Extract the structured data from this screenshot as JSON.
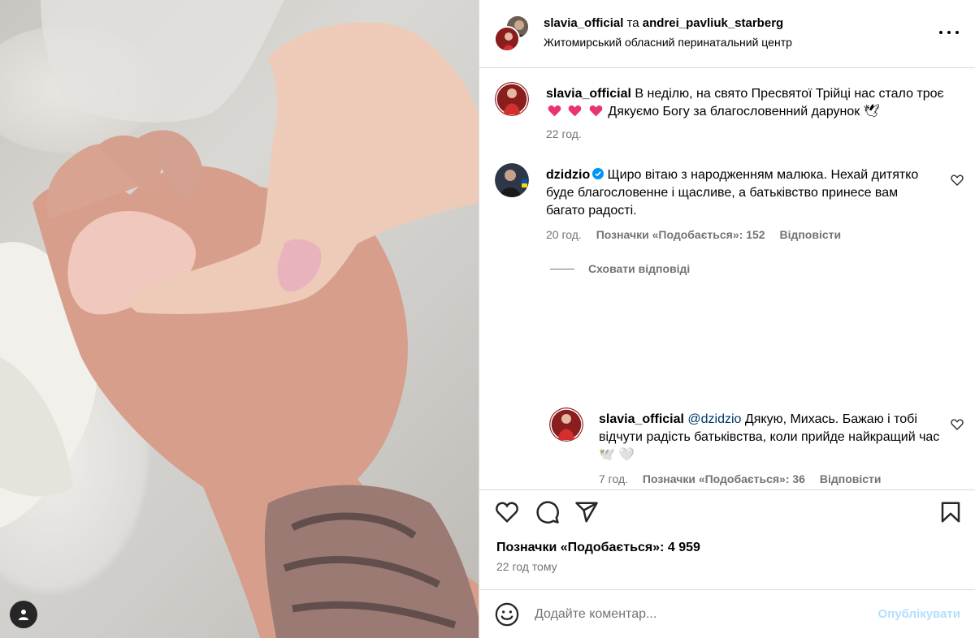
{
  "post": {
    "author": "slavia_official",
    "joiner": " та ",
    "coauthor": "andrei_pavliuk_starberg",
    "location": "Житомирський обласний перинатальний центр"
  },
  "caption": {
    "username": "slavia_official",
    "text_part1": "В неділю, на свято Пресвятої Трійці нас стало троє",
    "text_part2": "Дякуємо Богу за благословенний дарунок 🕊",
    "time": "22 год."
  },
  "comments": [
    {
      "username": "dzidzio",
      "verified": true,
      "text": "Щиро вітаю з народженням малюка. Нехай дитятко буде благословенне і щасливе, а батьківство принесе вам багато радості.",
      "time": "20 год.",
      "likes": "Позначки «Подобається»: 152",
      "reply_label": "Відповісти"
    }
  ],
  "hide_replies": "Сховати відповіді",
  "reply": {
    "username": "slavia_official",
    "mention": "@dzidzio",
    "text": "Дякую, Михась. Бажаю і тобі відчути радість батьківства, коли прийде найкращий час🕊️ 🤍",
    "time": "7 год.",
    "likes": "Позначки «Подобається»: 36",
    "reply_label": "Відповісти"
  },
  "likes_total": "Позначки «Подобається»: 4 959",
  "posted_ago": "22 год тому",
  "comment_box": {
    "placeholder": "Додайте коментар...",
    "post_label": "Опублікувати"
  },
  "colors": {
    "link": "#00376b",
    "secondary": "#737373",
    "post_button_disabled": "#b2dffc",
    "verified": "#0095f6",
    "heart_emoji": "#e8356d"
  },
  "icons": [
    "heart-icon",
    "comment-icon",
    "share-icon",
    "bookmark-icon",
    "more-icon",
    "emoji-icon",
    "user-tag-icon",
    "verified-icon"
  ]
}
